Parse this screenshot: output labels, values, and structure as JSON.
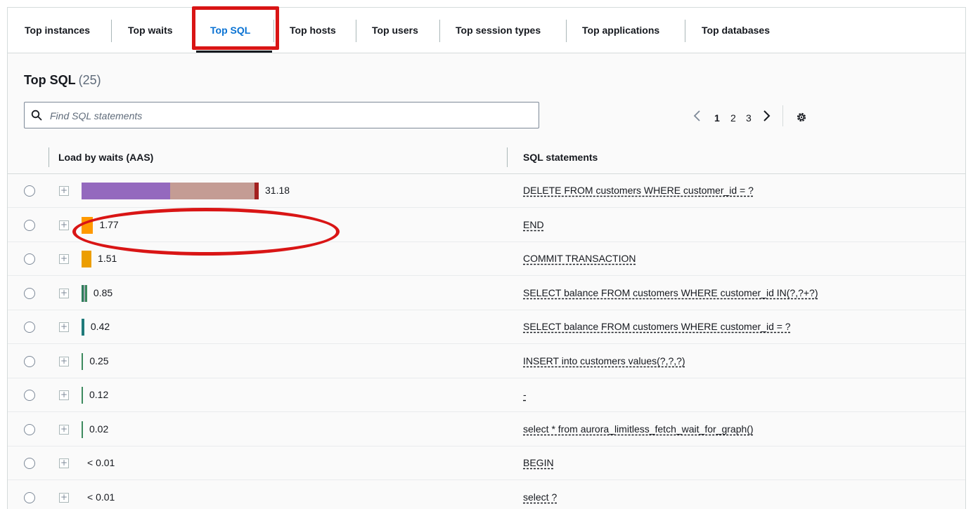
{
  "tabs": [
    {
      "label": "Top instances"
    },
    {
      "label": "Top waits"
    },
    {
      "label": "Top SQL",
      "active": true
    },
    {
      "label": "Top hosts"
    },
    {
      "label": "Top users"
    },
    {
      "label": "Top session types"
    },
    {
      "label": "Top applications"
    },
    {
      "label": "Top databases"
    }
  ],
  "panel": {
    "title": "Top SQL",
    "count": "(25)"
  },
  "search": {
    "placeholder": "Find SQL statements",
    "icon": "search-icon"
  },
  "pagination": {
    "pages": [
      "1",
      "2",
      "3"
    ],
    "current": "1",
    "prev_icon": "chevron-left-icon",
    "next_icon": "chevron-right-icon",
    "settings_icon": "gear-icon"
  },
  "table": {
    "columns": [
      "Load by waits (AAS)",
      "SQL statements"
    ],
    "rows": [
      {
        "load": "31.18",
        "sql": "DELETE FROM customers WHERE customer_id = ?",
        "segments": [
          {
            "value": 13.5,
            "color": "#9469be"
          },
          {
            "value": 13.0,
            "color": "#c49c94"
          },
          {
            "value": 0.6,
            "color": "#a3201f"
          }
        ]
      },
      {
        "load": "1.77",
        "sql": "END",
        "segments": [
          {
            "value": 1.77,
            "color": "#ff9900"
          }
        ]
      },
      {
        "load": "1.51",
        "sql": "COMMIT TRANSACTION",
        "segments": [
          {
            "value": 1.51,
            "color": "#ec9e00"
          }
        ]
      },
      {
        "load": "0.85",
        "sql": "SELECT balance FROM customers WHERE customer_id IN(?,?+?)",
        "segments": [
          {
            "value": 0.3,
            "color": "#2e7d5b"
          },
          {
            "value": 0.25,
            "color": "#a0a8b0"
          },
          {
            "value": 0.3,
            "color": "#3d8a5e"
          }
        ]
      },
      {
        "load": "0.42",
        "sql": "SELECT balance FROM customers WHERE customer_id = ?",
        "segments": [
          {
            "value": 0.42,
            "color": "#1f7a7a"
          }
        ]
      },
      {
        "load": "0.25",
        "sql": "INSERT into customers values(?,?,?)",
        "segments": [
          {
            "value": 0.25,
            "color": "#3d8a5e"
          }
        ]
      },
      {
        "load": "0.12",
        "sql": "-",
        "segments": [
          {
            "value": 0.12,
            "color": "#3d8a5e"
          }
        ]
      },
      {
        "load": "0.02",
        "sql": "select * from aurora_limitless_fetch_wait_for_graph()",
        "segments": [
          {
            "value": 0.02,
            "color": "#3d8a5e"
          }
        ]
      },
      {
        "load": "< 0.01",
        "sql": "BEGIN",
        "segments": []
      },
      {
        "load": "< 0.01",
        "sql": "select ?",
        "segments": []
      }
    ]
  },
  "colors": {
    "accent": "#0972d3",
    "highlight": "#d91515"
  }
}
